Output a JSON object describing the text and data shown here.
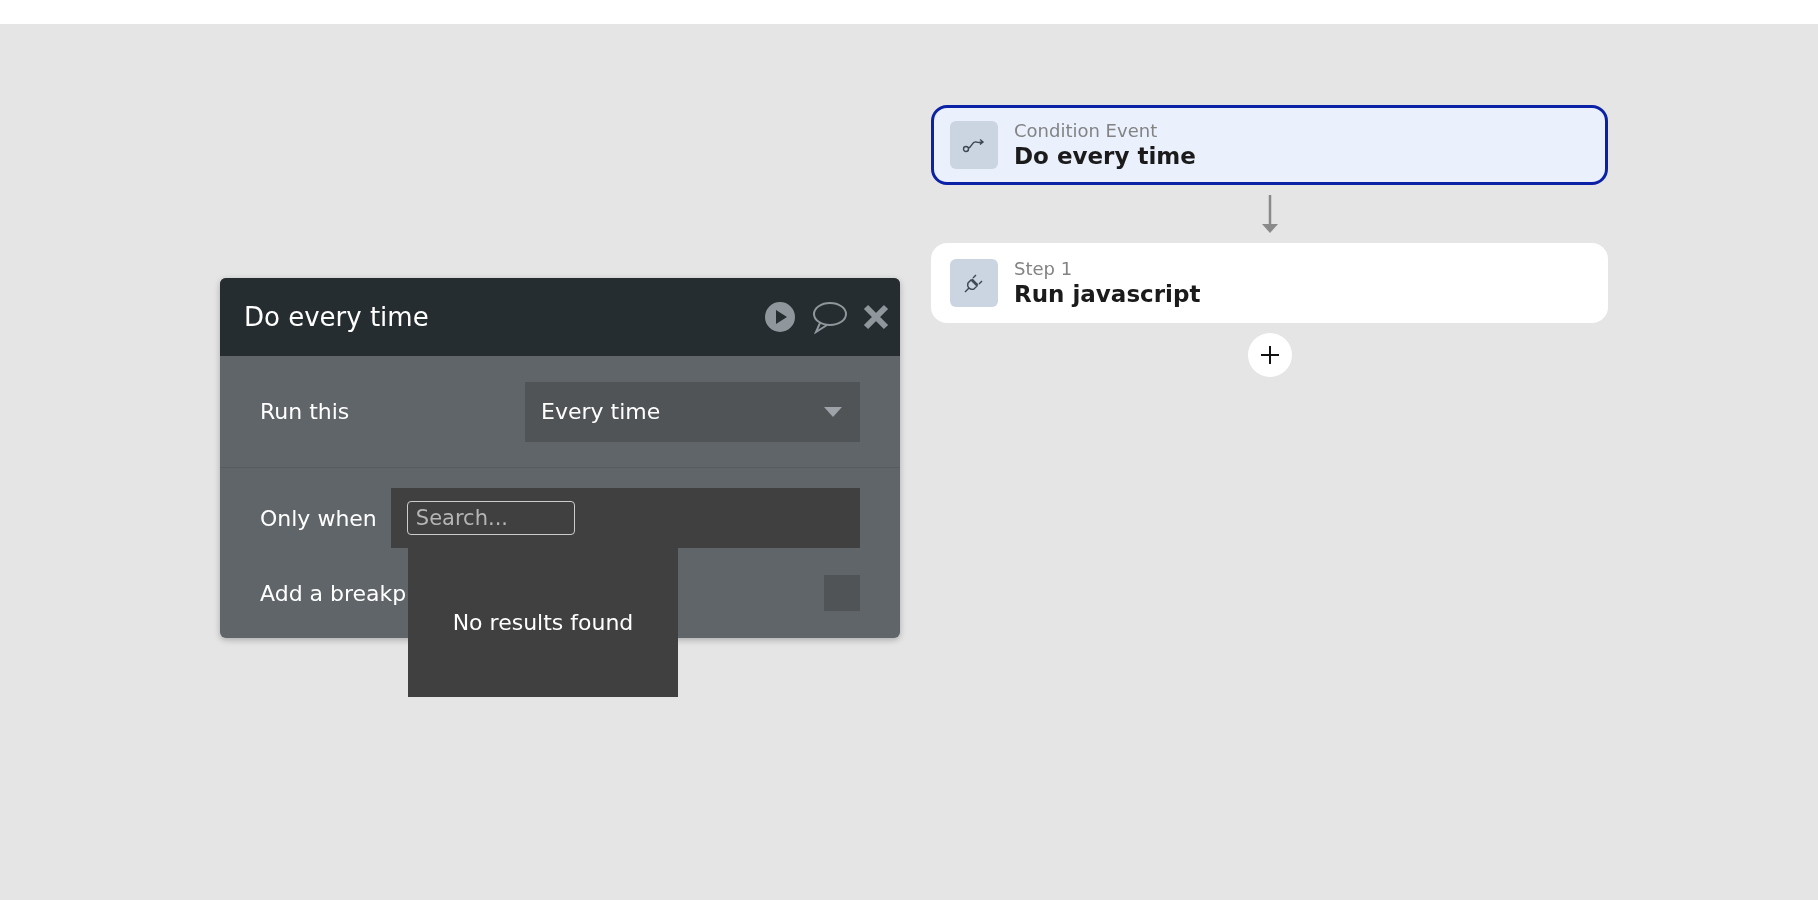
{
  "panel": {
    "title": "Do every time",
    "run_this": {
      "label": "Run this",
      "value": "Every time"
    },
    "only_when": {
      "label": "Only when",
      "search": {
        "placeholder": "Search..."
      },
      "results_message": "No results found"
    },
    "breakpoint": {
      "label": "Add a breakp",
      "checked": false
    }
  },
  "flow": {
    "cards": [
      {
        "kind": "event",
        "caption": "Condition Event",
        "title": "Do every time",
        "selected": true
      },
      {
        "kind": "action",
        "caption": "Step 1",
        "title": "Run javascript",
        "selected": false
      }
    ]
  }
}
